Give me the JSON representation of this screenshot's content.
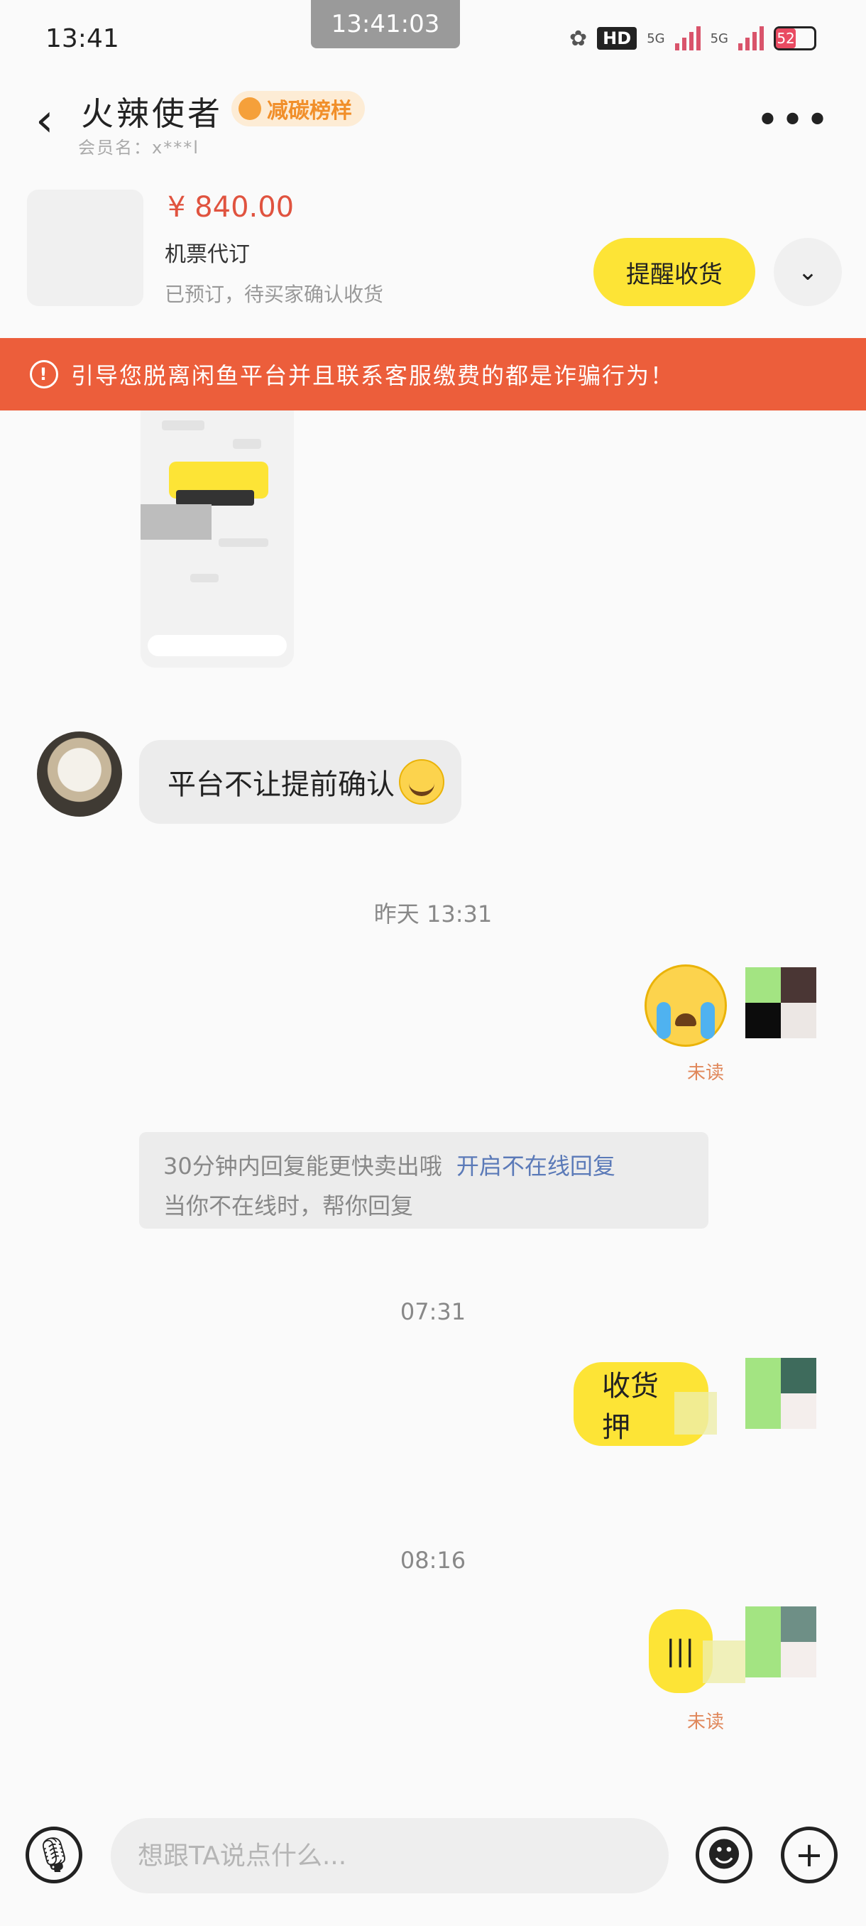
{
  "status_bar": {
    "time": "13:41",
    "clock_pill": "13:41:03",
    "network_1": "5G",
    "network_2": "5G",
    "hd_label": "HD",
    "battery": "52"
  },
  "header": {
    "contact_name": "火辣使者",
    "badge": "减碳榜样",
    "member_name": "会员名：x***l"
  },
  "order": {
    "price": "¥ 840.00",
    "title": "机票代订",
    "status": "已预订，待买家确认收货",
    "remind_button": "提醒收货"
  },
  "warning": {
    "text": "引导您脱离闲鱼平台并且联系客服缴费的都是诈骗行为！"
  },
  "messages": {
    "incoming_text": "平台不让提前确认",
    "time_1": "昨天 13:31",
    "read_1": "未读",
    "system_tip_line1": "30分钟内回复能更快卖出哦",
    "system_tip_link": "开启不在线回复",
    "system_tip_line2": "当你不在线时，帮你回复",
    "time_2": "07:31",
    "out_text_1": "收货押",
    "time_3": "08:16",
    "out_text_2": "|||",
    "read_2": "未读"
  },
  "input": {
    "placeholder": "想跟TA说点什么..."
  },
  "colors": {
    "accent_yellow": "#fde436",
    "warning_red": "#ec5e3b",
    "price_red": "#e0533f"
  }
}
